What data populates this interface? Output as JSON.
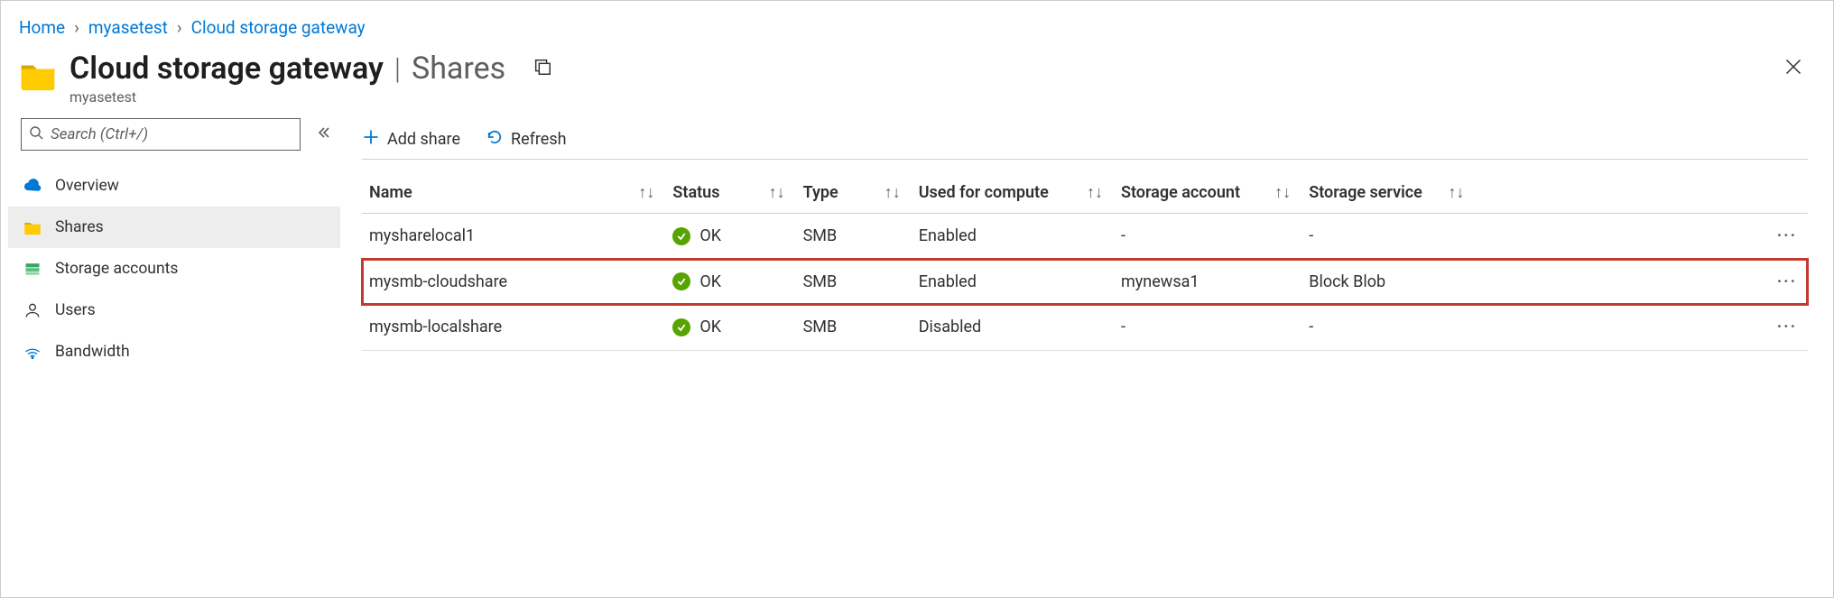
{
  "breadcrumb": {
    "items": [
      {
        "label": "Home"
      },
      {
        "label": "myasetest"
      },
      {
        "label": "Cloud storage gateway"
      }
    ]
  },
  "header": {
    "title": "Cloud storage gateway",
    "section": "Shares",
    "subtitle": "myasetest"
  },
  "sidebar": {
    "search_placeholder": "Search (Ctrl+/)",
    "items": [
      {
        "label": "Overview",
        "icon": "cloud-icon"
      },
      {
        "label": "Shares",
        "icon": "folder-icon",
        "active": true
      },
      {
        "label": "Storage accounts",
        "icon": "storage-icon"
      },
      {
        "label": "Users",
        "icon": "user-icon"
      },
      {
        "label": "Bandwidth",
        "icon": "bandwidth-icon"
      }
    ]
  },
  "toolbar": {
    "add": "Add share",
    "refresh": "Refresh"
  },
  "table": {
    "columns": {
      "name": "Name",
      "status": "Status",
      "type": "Type",
      "compute": "Used for compute",
      "account": "Storage account",
      "service": "Storage service"
    },
    "rows": [
      {
        "name": "mysharelocal1",
        "status": "OK",
        "type": "SMB",
        "compute": "Enabled",
        "account": "-",
        "service": "-"
      },
      {
        "name": "mysmb-cloudshare",
        "status": "OK",
        "type": "SMB",
        "compute": "Enabled",
        "account": "mynewsa1",
        "service": "Block Blob",
        "highlight": true
      },
      {
        "name": "mysmb-localshare",
        "status": "OK",
        "type": "SMB",
        "compute": "Disabled",
        "account": "-",
        "service": "-"
      }
    ]
  }
}
